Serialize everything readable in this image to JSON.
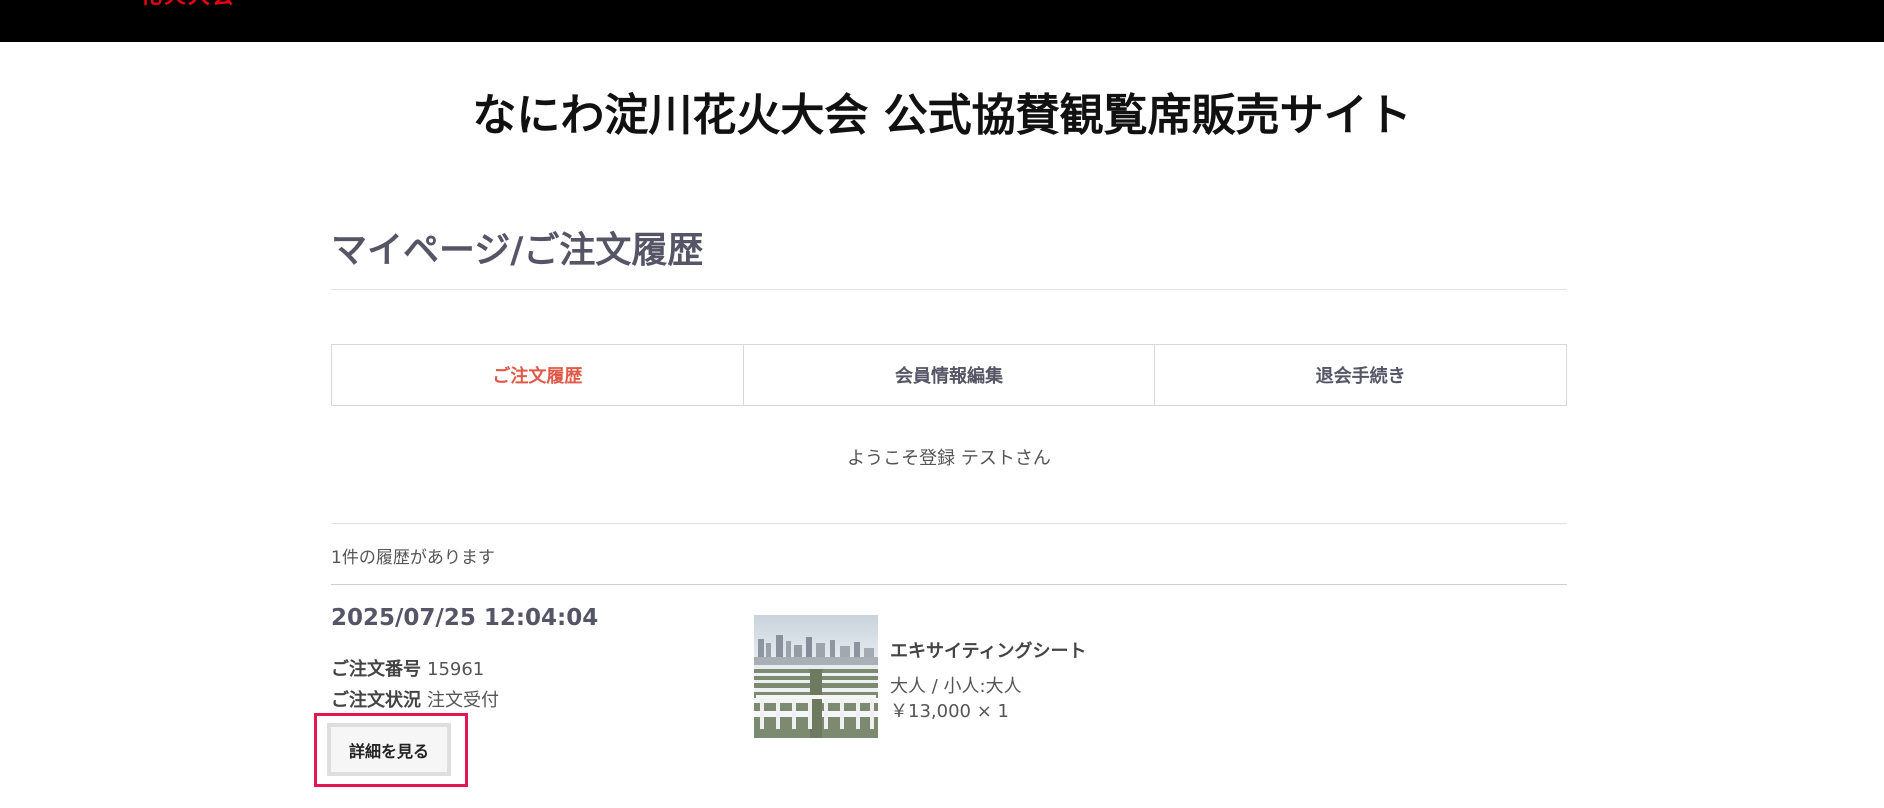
{
  "header": {
    "logo_text": "花火大会"
  },
  "site_title": "なにわ淀川花火大会 公式協賛観覧席販売サイト",
  "page_heading": "マイページ/ご注文履歴",
  "tabs": [
    {
      "label": "ご注文履歴",
      "active": true
    },
    {
      "label": "会員情報編集",
      "active": false
    },
    {
      "label": "退会手続き",
      "active": false
    }
  ],
  "welcome": "ようこそ登録 テストさん",
  "history_count": "1件の履歴があります",
  "order": {
    "datetime": "2025/07/25 12:04:04",
    "number_label": "ご注文番号",
    "number": "15961",
    "status_label": "ご注文状況",
    "status": "注文受付",
    "detail_button": "詳細を見る",
    "item": {
      "name": "エキサイティングシート",
      "type": "大人 / 小人:大人",
      "price": "￥13,000 × 1"
    }
  },
  "colors": {
    "accent": "#e05a4a",
    "highlight": "#e3174f",
    "header_bg": "#000000",
    "logo": "#e60012"
  }
}
